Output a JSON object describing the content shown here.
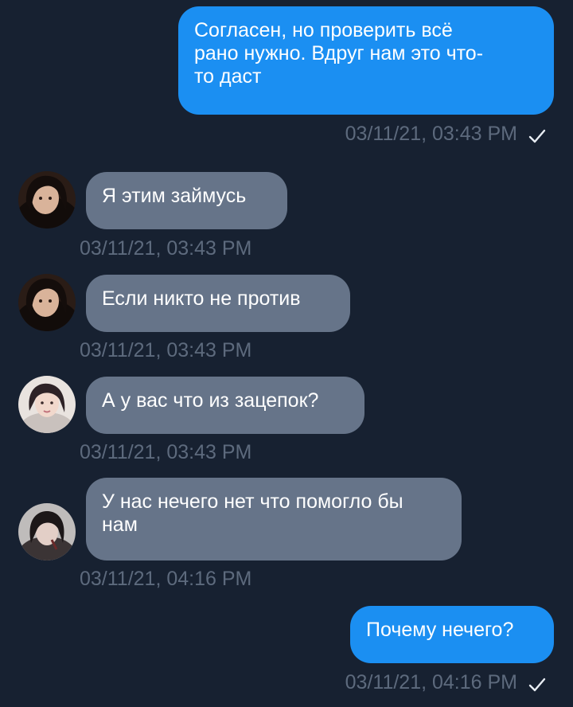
{
  "messages": [
    {
      "direction": "outgoing",
      "text": "Согласен, но проверить всё\nрано нужно. Вдруг нам это что-\nто даст",
      "timestamp": "03/11/21, 03:43 PM",
      "read_check": true
    },
    {
      "direction": "incoming",
      "text": "Я этим займусь",
      "timestamp": "03/11/21, 03:43 PM",
      "avatar": "user-avatar-dark-hair"
    },
    {
      "direction": "incoming",
      "text": "Если никто не против",
      "timestamp": "03/11/21, 03:43 PM",
      "avatar": "user-avatar-dark-hair"
    },
    {
      "direction": "incoming",
      "text": "А у вас что из зацепок?",
      "timestamp": "03/11/21, 03:43 PM",
      "avatar": "user-avatar-light"
    },
    {
      "direction": "incoming",
      "text": "У нас нечего нет что помогло бы\nнам",
      "timestamp": "03/11/21, 04:16 PM",
      "avatar": "user-avatar-grey"
    },
    {
      "direction": "outgoing",
      "text": "Почему нечего?",
      "timestamp": "03/11/21, 04:16 PM",
      "read_check": true
    }
  ],
  "colors": {
    "background": "#172131",
    "outgoing_bubble": "#1b8ff2",
    "incoming_bubble": "#667489",
    "timestamp": "#5d6a7d",
    "text": "#ffffff"
  },
  "icons": {
    "read_receipt": "checkmark-icon"
  }
}
